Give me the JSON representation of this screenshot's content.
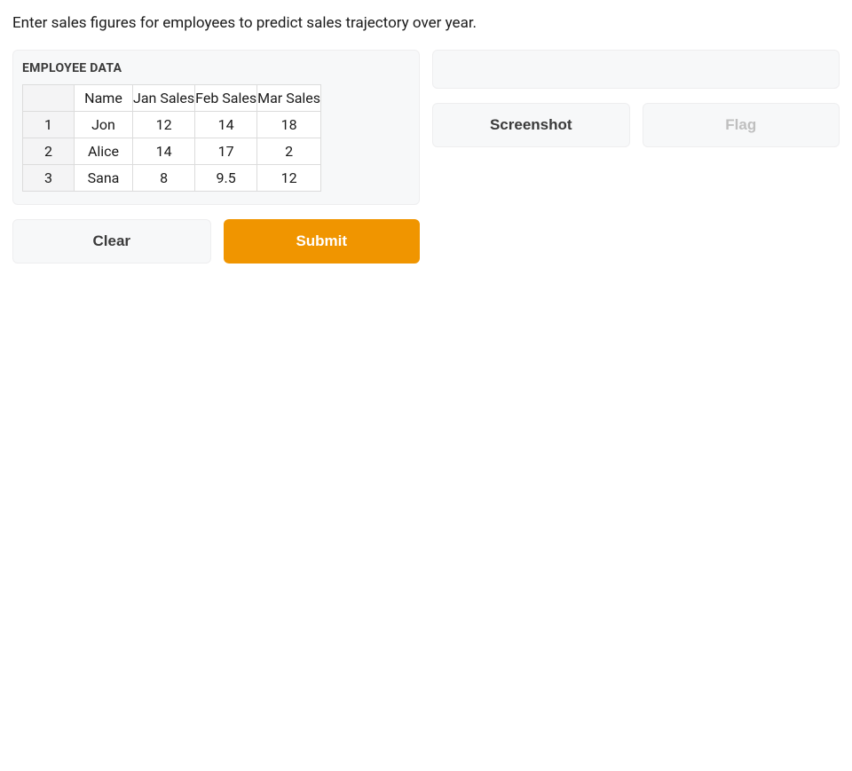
{
  "description": "Enter sales figures for employees to predict sales trajectory over year.",
  "input": {
    "label": "EMPLOYEE DATA",
    "columns": [
      "Name",
      "Jan Sales",
      "Feb Sales",
      "Mar Sales"
    ],
    "row_indices": [
      "1",
      "2",
      "3"
    ],
    "rows": [
      {
        "name": "Jon",
        "jan": "12",
        "feb": "14",
        "mar": "18"
      },
      {
        "name": "Alice",
        "jan": "14",
        "feb": "17",
        "mar": "2"
      },
      {
        "name": "Sana",
        "jan": "8",
        "feb": "9.5",
        "mar": "12"
      }
    ]
  },
  "buttons": {
    "clear": "Clear",
    "submit": "Submit",
    "screenshot": "Screenshot",
    "flag": "Flag"
  }
}
